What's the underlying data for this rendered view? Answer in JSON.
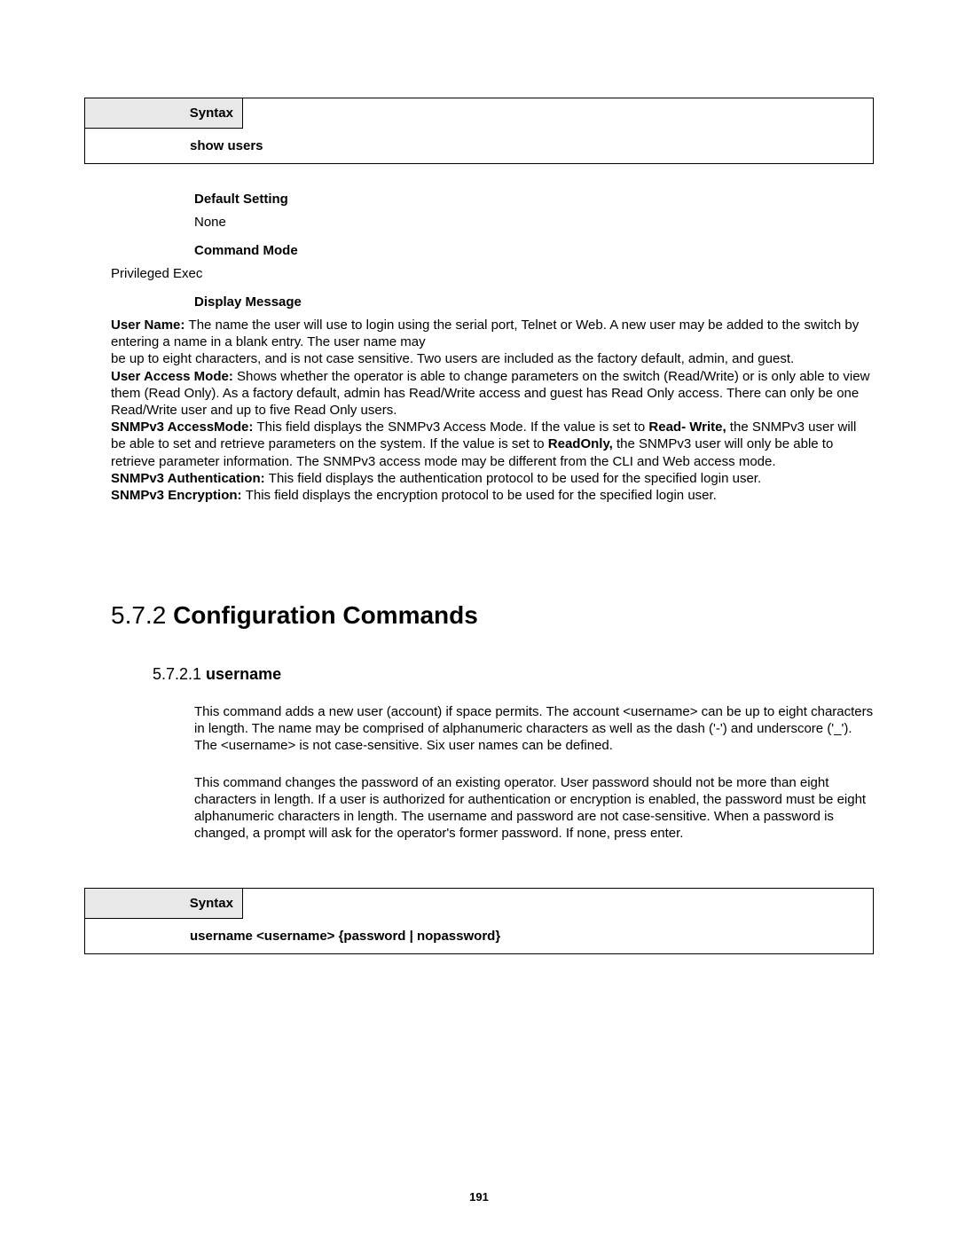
{
  "syntax1": {
    "header": "Syntax",
    "body": "show users"
  },
  "defaultSetting": {
    "label": "Default Setting",
    "value": "None"
  },
  "commandMode": {
    "label": "Command Mode",
    "value": "Privileged Exec"
  },
  "displayMessage": {
    "label": "Display Message"
  },
  "userName": {
    "bold": "User Name: ",
    "text": "The name the user will use to login using the serial port, Telnet or Web. A new user may be added to the switch by entering a name in a blank entry. The user name may"
  },
  "userNameLine2": "be up to eight characters, and is not case sensitive. Two users are included as the factory default, admin, and guest.",
  "userAccessMode": {
    "bold": "User Access Mode: ",
    "text": "Shows whether the operator is able to change parameters on the switch (Read/Write) or is only able to view them (Read Only). As a factory default, admin has Read/Write access and guest has Read Only access. There can only be one Read/Write user and up to five Read Only users."
  },
  "snmpAccessMode": {
    "bold": "SNMPv3 AccessMode: ",
    "text1": "This field displays the SNMPv3 Access Mode. If the value is set to ",
    "bold2": "Read- Write,",
    "text2": " the SNMPv3 user will be able to set and retrieve parameters on the system. If the value is set to ",
    "bold3": "ReadOnly,",
    "text3": " the SNMPv3 user will only be able to retrieve parameter information. The SNMPv3 access mode may be different from the CLI and Web access mode."
  },
  "snmpAuth": {
    "bold": "SNMPv3 Authentication: ",
    "text": "This field displays the authentication protocol to be used for the specified login user."
  },
  "snmpEncrypt": {
    "bold": "SNMPv3 Encryption: ",
    "text": "This field displays the encryption protocol to be used for the specified login user."
  },
  "heading": {
    "num": "5.7.2 ",
    "title": "Configuration Commands"
  },
  "subheading": {
    "num": "5.7.2.1 ",
    "title": "username"
  },
  "para1": "This command adds a new user (account) if space permits. The account <username> can be up to eight characters in length. The name may be comprised of alphanumeric characters as well as the dash ('-') and underscore ('_'). The <username> is not case-sensitive. Six user names can be defined.",
  "para2": "This command changes the password of an existing operator. User password should not be more than eight characters in length. If a user is authorized for authentication or encryption is enabled, the password must be eight alphanumeric characters in length. The username and password are not case-sensitive. When a password is changed, a prompt will ask for the operator's former password. If none, press enter.",
  "syntax2": {
    "header": "Syntax",
    "body": "username <username> {password | nopassword}"
  },
  "pageNum": "191"
}
